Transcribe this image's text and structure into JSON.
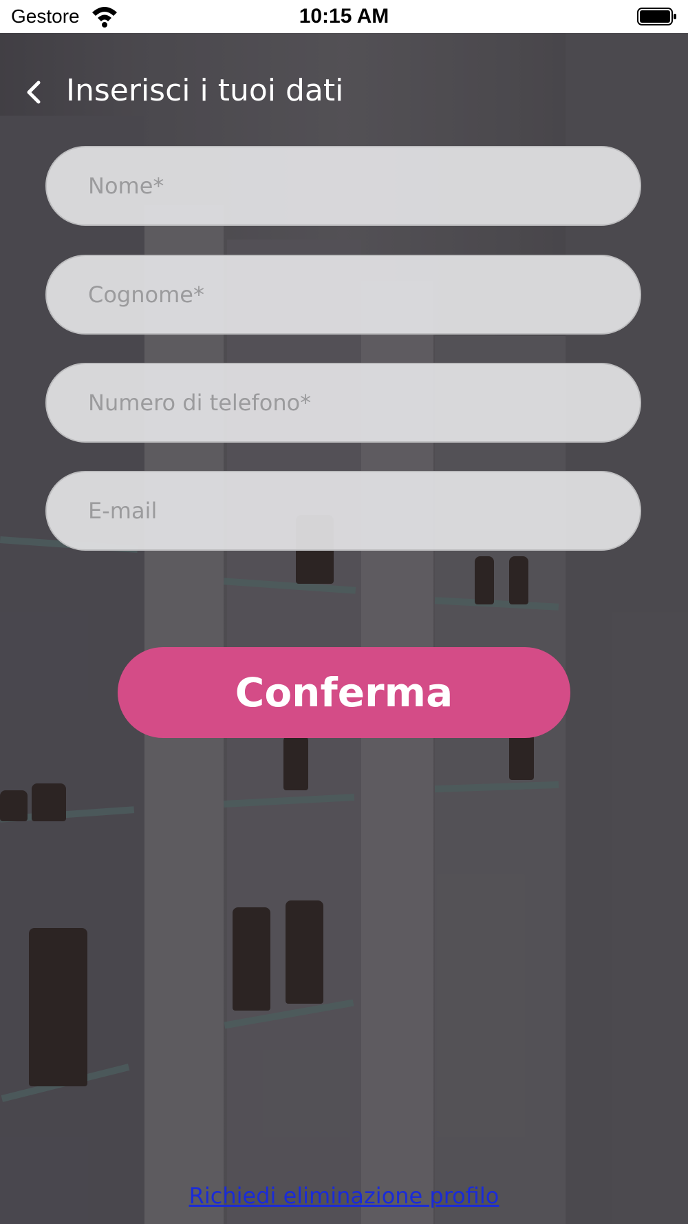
{
  "status_bar": {
    "carrier": "Gestore",
    "time": "10:15 AM",
    "wifi_icon": "wifi-icon",
    "battery_icon": "battery-icon"
  },
  "header": {
    "back_icon": "chevron-left-icon",
    "title": "Inserisci i tuoi dati"
  },
  "form": {
    "first_name": {
      "placeholder": "Nome*",
      "value": ""
    },
    "last_name": {
      "placeholder": "Cognome*",
      "value": ""
    },
    "phone": {
      "placeholder": "Numero di telefono*",
      "value": ""
    },
    "email": {
      "placeholder": "E-mail",
      "value": ""
    }
  },
  "confirm_label": "Conferma",
  "delete_profile_link": "Richiedi eliminazione profilo",
  "colors": {
    "accent": "#d44c87",
    "link": "#1a2bd8"
  }
}
